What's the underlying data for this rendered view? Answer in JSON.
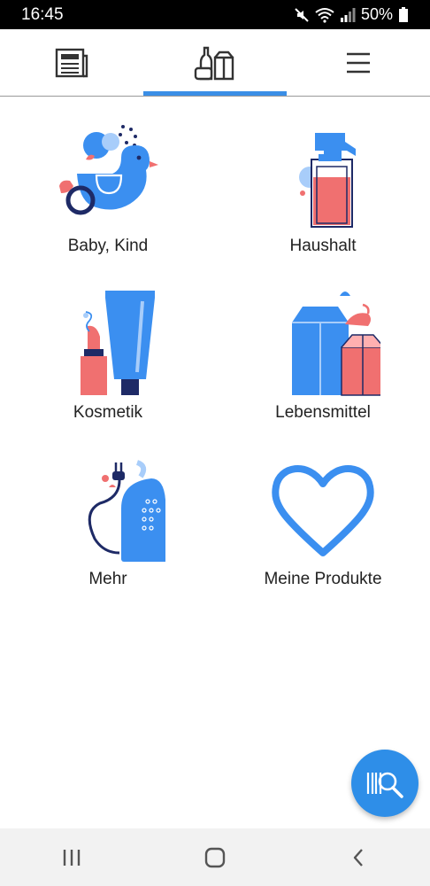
{
  "status_bar": {
    "time": "16:45",
    "battery": "50%"
  },
  "tabs": [
    {
      "name": "news",
      "icon": "newspaper-icon"
    },
    {
      "name": "products",
      "icon": "products-icon",
      "active": true
    },
    {
      "name": "menu",
      "icon": "hamburger-menu-icon"
    }
  ],
  "categories": [
    {
      "label": "Baby, Kind",
      "icon": "baby-kind-icon"
    },
    {
      "label": "Haushalt",
      "icon": "haushalt-icon"
    },
    {
      "label": "Kosmetik",
      "icon": "kosmetik-icon"
    },
    {
      "label": "Lebensmittel",
      "icon": "lebensmittel-icon"
    },
    {
      "label": "Mehr",
      "icon": "mehr-icon"
    },
    {
      "label": "Meine Produkte",
      "icon": "heart-icon"
    }
  ],
  "fab": {
    "icon": "barcode-search-icon"
  },
  "navigation": [
    "recent-apps-icon",
    "home-icon",
    "back-icon"
  ],
  "colors": {
    "accent": "#3a8ee6",
    "illustration_blue": "#3b8ff0",
    "illustration_red": "#f07070",
    "navy": "#1e2a66"
  }
}
